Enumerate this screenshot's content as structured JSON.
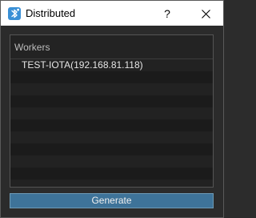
{
  "window": {
    "title": "Distributed",
    "help_label": "?",
    "app_icon": "bluetooth-network-icon",
    "close_icon": "close-icon"
  },
  "workers": {
    "header": "Workers",
    "items": [
      {
        "label": "TEST-IOTA(192.168.81.118)"
      }
    ]
  },
  "actions": {
    "generate_label": "Generate"
  },
  "colors": {
    "titlebar_bg": "#ffffff",
    "window_bg": "#2b2b2b",
    "list_bg": "#1c1c1c",
    "button_bg": "#3e7399",
    "app_icon_bg": "#3a90d6"
  }
}
